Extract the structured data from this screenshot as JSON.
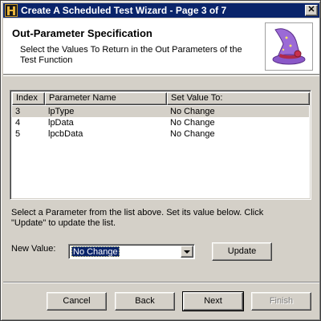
{
  "window": {
    "title": "Create A Scheduled Test Wizard - Page 3 of 7",
    "close_glyph": "✕"
  },
  "header": {
    "title": "Out-Parameter Specification",
    "subtitle": "Select the Values To Return in the Out Parameters of the Test Function",
    "image_icon": "wizard-hat-icon"
  },
  "list": {
    "columns": [
      "Index",
      "Parameter Name",
      "Set Value To:"
    ],
    "rows": [
      {
        "index": "3",
        "name": "lpType",
        "value": "No Change"
      },
      {
        "index": "4",
        "name": "lpData",
        "value": "No Change"
      },
      {
        "index": "5",
        "name": "lpcbData",
        "value": "No Change"
      }
    ],
    "selected_row": 0
  },
  "hint": "Select a Parameter from the list above.  Set its value below.  Click \"Update\" to update the list.",
  "new_value": {
    "label": "New Value:",
    "selected": "No Change"
  },
  "buttons": {
    "update": "Update",
    "cancel": "Cancel",
    "back": "Back",
    "next": "Next",
    "finish": "Finish"
  },
  "colors": {
    "titlebar": "#0a246a",
    "face": "#d4d0c8",
    "selection": "#0a246a"
  }
}
